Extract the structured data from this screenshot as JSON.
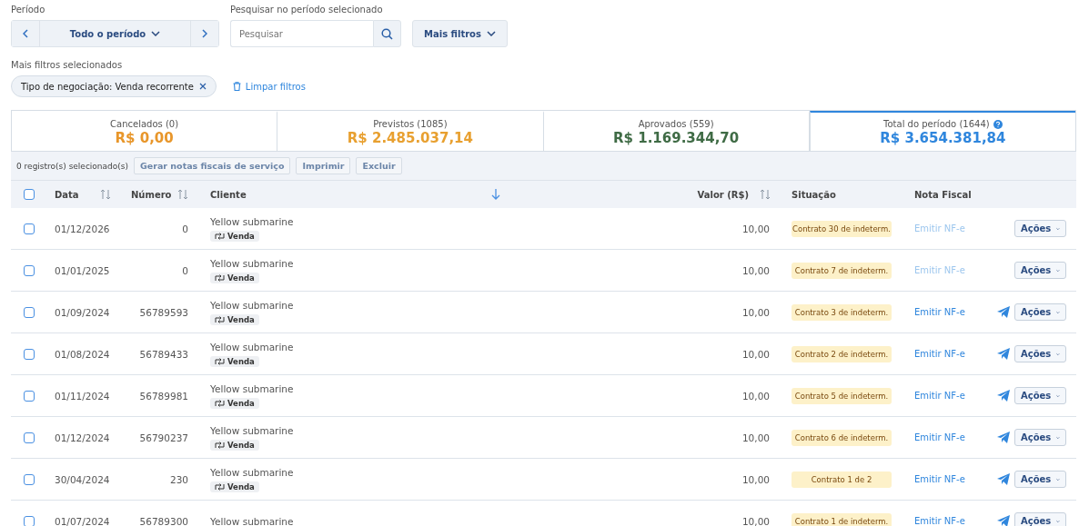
{
  "period": {
    "label": "Período",
    "value": "Todo o período"
  },
  "search": {
    "label": "Pesquisar no período selecionado",
    "placeholder": "Pesquisar"
  },
  "more_filters_button": "Mais filtros",
  "selected_filters": {
    "label": "Mais filtros selecionados",
    "chips": [
      "Tipo de negociação: Venda recorrente"
    ],
    "clear": "Limpar filtros"
  },
  "summary": [
    {
      "label": "Cancelados (0)",
      "amount": "R$ 0,00",
      "color": "#e8962a",
      "selected": false,
      "help": false
    },
    {
      "label": "Previstos (1085)",
      "amount": "R$ 2.485.037,14",
      "color": "#e8a030",
      "selected": false,
      "help": false
    },
    {
      "label": "Aprovados (559)",
      "amount": "R$ 1.169.344,70",
      "color": "#3f6b45",
      "selected": false,
      "help": false
    },
    {
      "label": "Total do período (1644)",
      "amount": "R$ 3.654.381,84",
      "color": "#2f86dd",
      "selected": true,
      "help": true
    }
  ],
  "toolbar": {
    "count": "0 registro(s) selecionado(s)",
    "buttons": [
      "Gerar notas fiscais de serviço",
      "Imprimir",
      "Excluir"
    ]
  },
  "table": {
    "select_all_checked": false,
    "columns": [
      "Data",
      "Número",
      "Cliente",
      "Valor (R$)",
      "Situação",
      "Nota Fiscal"
    ],
    "rows": [
      {
        "checked": false,
        "date": "01/12/2026",
        "number": "0",
        "client": "Yellow submarine",
        "tag": "Venda",
        "value": "10,00",
        "status": "Contrato 30 de indeterm.",
        "invoice": "Emitir NF-e",
        "disabled": true,
        "actions": "Ações"
      },
      {
        "checked": false,
        "date": "01/01/2025",
        "number": "0",
        "client": "Yellow submarine",
        "tag": "Venda",
        "value": "10,00",
        "status": "Contrato 7 de indeterm.",
        "invoice": "Emitir NF-e",
        "disabled": true,
        "actions": "Ações"
      },
      {
        "checked": false,
        "date": "01/09/2024",
        "number": "56789593",
        "client": "Yellow submarine",
        "tag": "Venda",
        "value": "10,00",
        "status": "Contrato 3 de indeterm.",
        "invoice": "Emitir NF-e",
        "disabled": false,
        "actions": "Ações"
      },
      {
        "checked": false,
        "date": "01/08/2024",
        "number": "56789433",
        "client": "Yellow submarine",
        "tag": "Venda",
        "value": "10,00",
        "status": "Contrato 2 de indeterm.",
        "invoice": "Emitir NF-e",
        "disabled": false,
        "actions": "Ações"
      },
      {
        "checked": false,
        "date": "01/11/2024",
        "number": "56789981",
        "client": "Yellow submarine",
        "tag": "Venda",
        "value": "10,00",
        "status": "Contrato 5 de indeterm.",
        "invoice": "Emitir NF-e",
        "disabled": false,
        "actions": "Ações"
      },
      {
        "checked": false,
        "date": "01/12/2024",
        "number": "56790237",
        "client": "Yellow submarine",
        "tag": "Venda",
        "value": "10,00",
        "status": "Contrato 6 de indeterm.",
        "invoice": "Emitir NF-e",
        "disabled": false,
        "actions": "Ações"
      },
      {
        "checked": false,
        "date": "30/04/2024",
        "number": "230",
        "client": "Yellow submarine",
        "tag": "Venda",
        "value": "10,00",
        "status": "Contrato 1 de 2",
        "invoice": "Emitir NF-e",
        "disabled": false,
        "actions": "Ações"
      },
      {
        "checked": false,
        "date": "01/07/2024",
        "number": "56789300",
        "client": "Yellow submarine",
        "value": "10,00",
        "status": "Contrato 1 de indeterm.",
        "invoice": "Emitir NF-e",
        "disabled": false,
        "actions": "Ações"
      }
    ]
  }
}
